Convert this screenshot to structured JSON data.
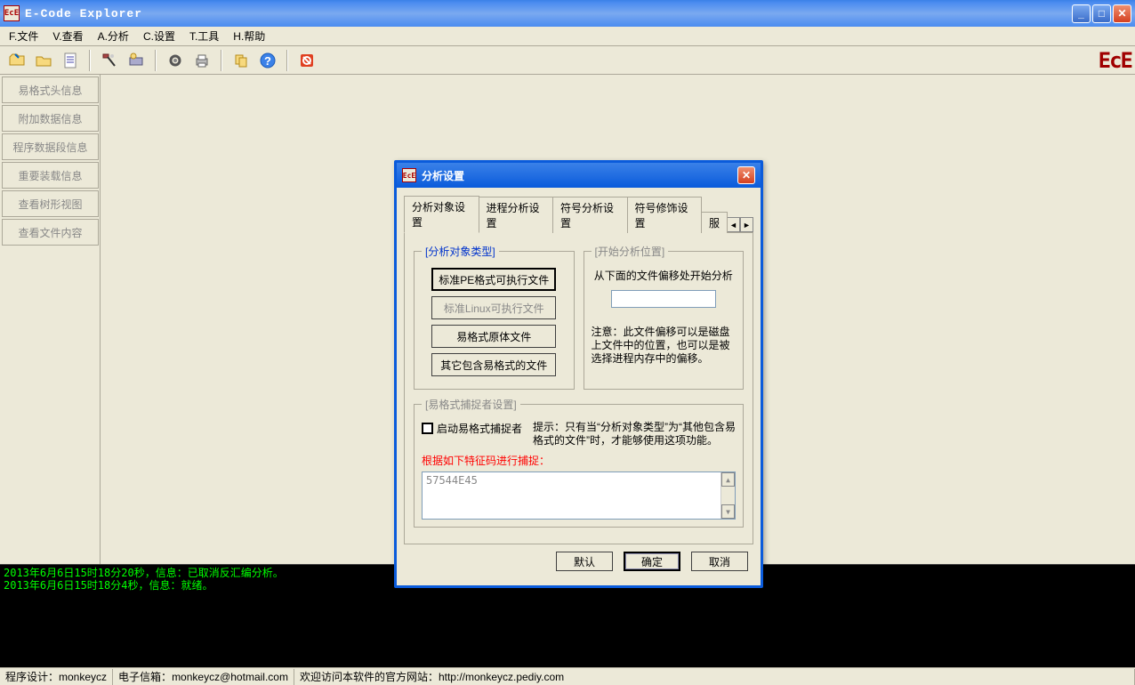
{
  "window": {
    "title": "E-Code Explorer"
  },
  "menu": {
    "file": "F.文件",
    "view": "V.查看",
    "analyze": "A.分析",
    "settings": "C.设置",
    "tools": "T.工具",
    "help": "H.帮助"
  },
  "toolbar_icons": {
    "open_file": "open-file-icon",
    "open_folder": "open-folder-icon",
    "doc": "document-icon",
    "tool1": "hammer-icon",
    "tool2": "module-icon",
    "gear": "gear-icon",
    "print": "print-icon",
    "copy": "copy-icon",
    "help": "help-icon",
    "stop": "stop-icon"
  },
  "sidebar": {
    "items": [
      {
        "label": "易格式头信息"
      },
      {
        "label": "附加数据信息"
      },
      {
        "label": "程序数据段信息"
      },
      {
        "label": "重要装载信息"
      },
      {
        "label": "查看树形视图"
      },
      {
        "label": "查看文件内容"
      }
    ]
  },
  "dialog": {
    "title": "分析设置",
    "tabs": {
      "t0": "分析对象设置",
      "t1": "进程分析设置",
      "t2": "符号分析设置",
      "t3": "符号修饰设置",
      "t4": "服"
    },
    "group_type_legend": "[分析对象类型]",
    "type_buttons": {
      "pe": "标准PE格式可执行文件",
      "linux": "标准Linux可执行文件",
      "eorig": "易格式原体文件",
      "other": "其它包含易格式的文件"
    },
    "group_pos_legend": "[开始分析位置]",
    "pos_label": "从下面的文件偏移处开始分析",
    "offset_value": "",
    "pos_note": "注意：此文件偏移可以是磁盘上文件中的位置，也可以是被选择进程内存中的偏移。",
    "group_cap_legend": "[易格式捕捉者设置]",
    "cap_checkbox": "启动易格式捕捉者",
    "cap_hint": "提示：只有当“分析对象类型”为“其他包含易格式的文件”时，才能够使用这项功能。",
    "cap_redlabel": "根据如下特征码进行捕捉：",
    "signature": "57544E45",
    "buttons": {
      "default": "默认",
      "ok": "确定",
      "cancel": "取消"
    }
  },
  "console": {
    "line1": "2013年6月6日15时18分20秒，信息：已取消反汇编分析。",
    "line2": "2013年6月6日15时18分4秒，信息：就绪。"
  },
  "status": {
    "designer_label": "程序设计：",
    "designer_value": "monkeycz",
    "email_label": "电子信箱：",
    "email_value": "monkeycz@hotmail.com",
    "site_label": "欢迎访问本软件的官方网站：",
    "site_value": "http://monkeycz.pediy.com"
  }
}
